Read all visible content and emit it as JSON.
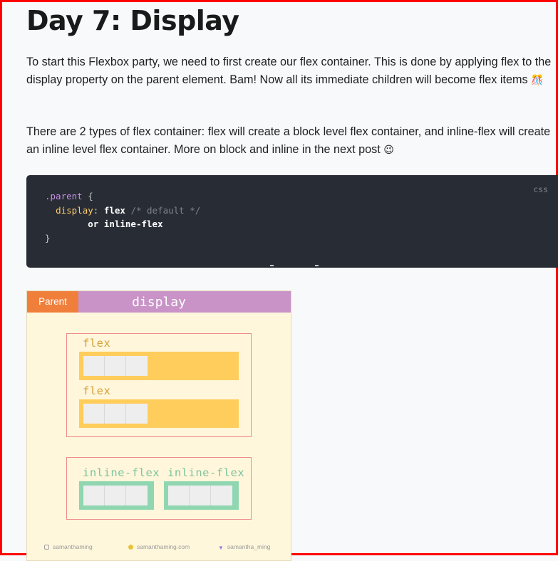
{
  "page": {
    "title": "Day 7: Display",
    "para1_pre": "To start this Flexbox party, we need to first create our flex container. This is done by applying flex to the display property on the parent element. Bam! Now all its immediate children will become flex items",
    "para1_emoji": "🎊",
    "para2_pre": "There are 2 types of flex container: flex will create a block level flex container, and inline-flex will create an inline level flex container. More on block and inline in the next post",
    "para2_emoji": "😉"
  },
  "code": {
    "language": "css",
    "selector": ".parent",
    "open_brace": " {",
    "property": "display",
    "colon": ": ",
    "value1": "flex",
    "comment": " /* default */",
    "or_text": "or inline-flex",
    "close_brace": "}"
  },
  "diagram": {
    "parent_label": "Parent",
    "title": "display",
    "flex_label_1": "flex",
    "flex_label_2": "flex",
    "inline_label_1": "inline-flex",
    "inline_label_2": "inline-flex",
    "footer_instagram": "samanthaming",
    "footer_site": "samanthaming.com",
    "footer_twitter": "samantha_ming",
    "colors": {
      "header": "#c993c8",
      "parent_tab": "#f07f3c",
      "background": "#fff7dc",
      "flex_bar": "#ffcd5c",
      "inline_bar": "#8fd6b1",
      "box_border": "#f08a8a"
    }
  }
}
